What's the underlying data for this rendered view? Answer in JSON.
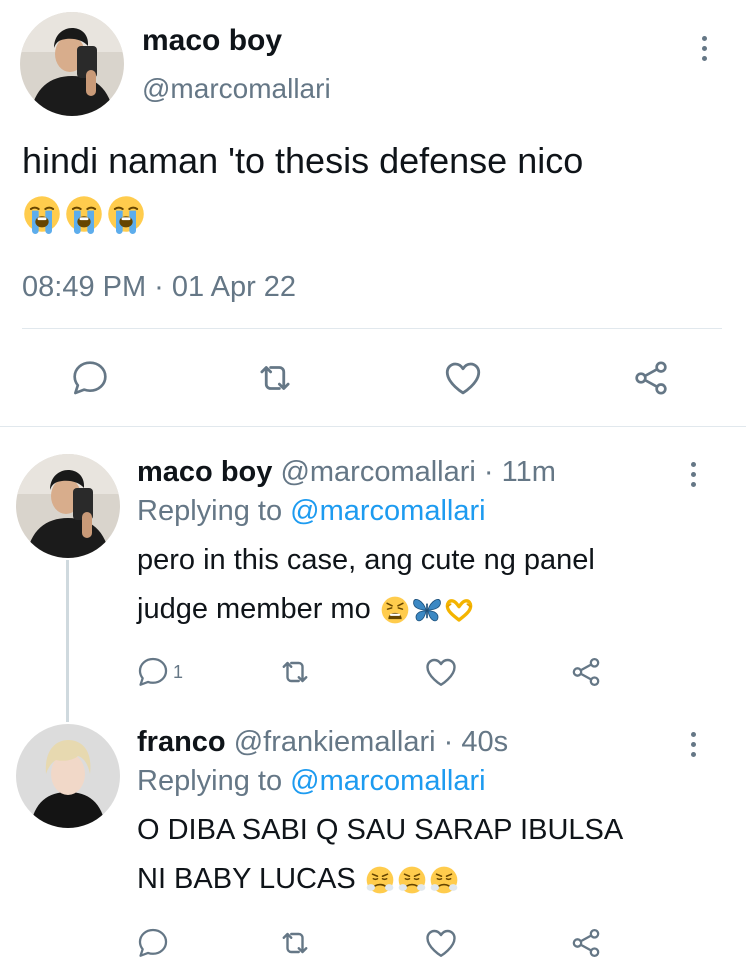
{
  "main_tweet": {
    "display_name": "maco boy",
    "handle": "@marcomallari",
    "text": "hindi naman 'to thesis defense nico",
    "emojis": [
      "loudly-crying-face",
      "loudly-crying-face",
      "loudly-crying-face"
    ],
    "timestamp": "08:49 PM · 01 Apr 22"
  },
  "replies": [
    {
      "display_name": "maco boy",
      "handle": "@marcomallari",
      "time": "· 11m",
      "replying_prefix": "Replying to",
      "replying_handle": "@marcomallari",
      "line1": "pero in this case, ang cute ng panel",
      "line2": "judge member mo",
      "emojis": [
        "weary-face",
        "blue-butterfly",
        "heart-hands"
      ],
      "reply_count": "1"
    },
    {
      "display_name": "franco",
      "handle": "@frankiemallari",
      "time": "· 40s",
      "replying_prefix": "Replying to",
      "replying_handle": "@marcomallari",
      "line1": "O DIBA SABI Q SAU SARAP IBULSA",
      "line2": "NI BABY LUCAS",
      "emojis": [
        "face-with-steam",
        "face-with-steam",
        "face-with-steam"
      ],
      "reply_count": ""
    }
  ],
  "colors": {
    "link": "#1d9bf0",
    "muted": "#657786",
    "divider": "#e1e8ed",
    "text": "#0f1419"
  }
}
